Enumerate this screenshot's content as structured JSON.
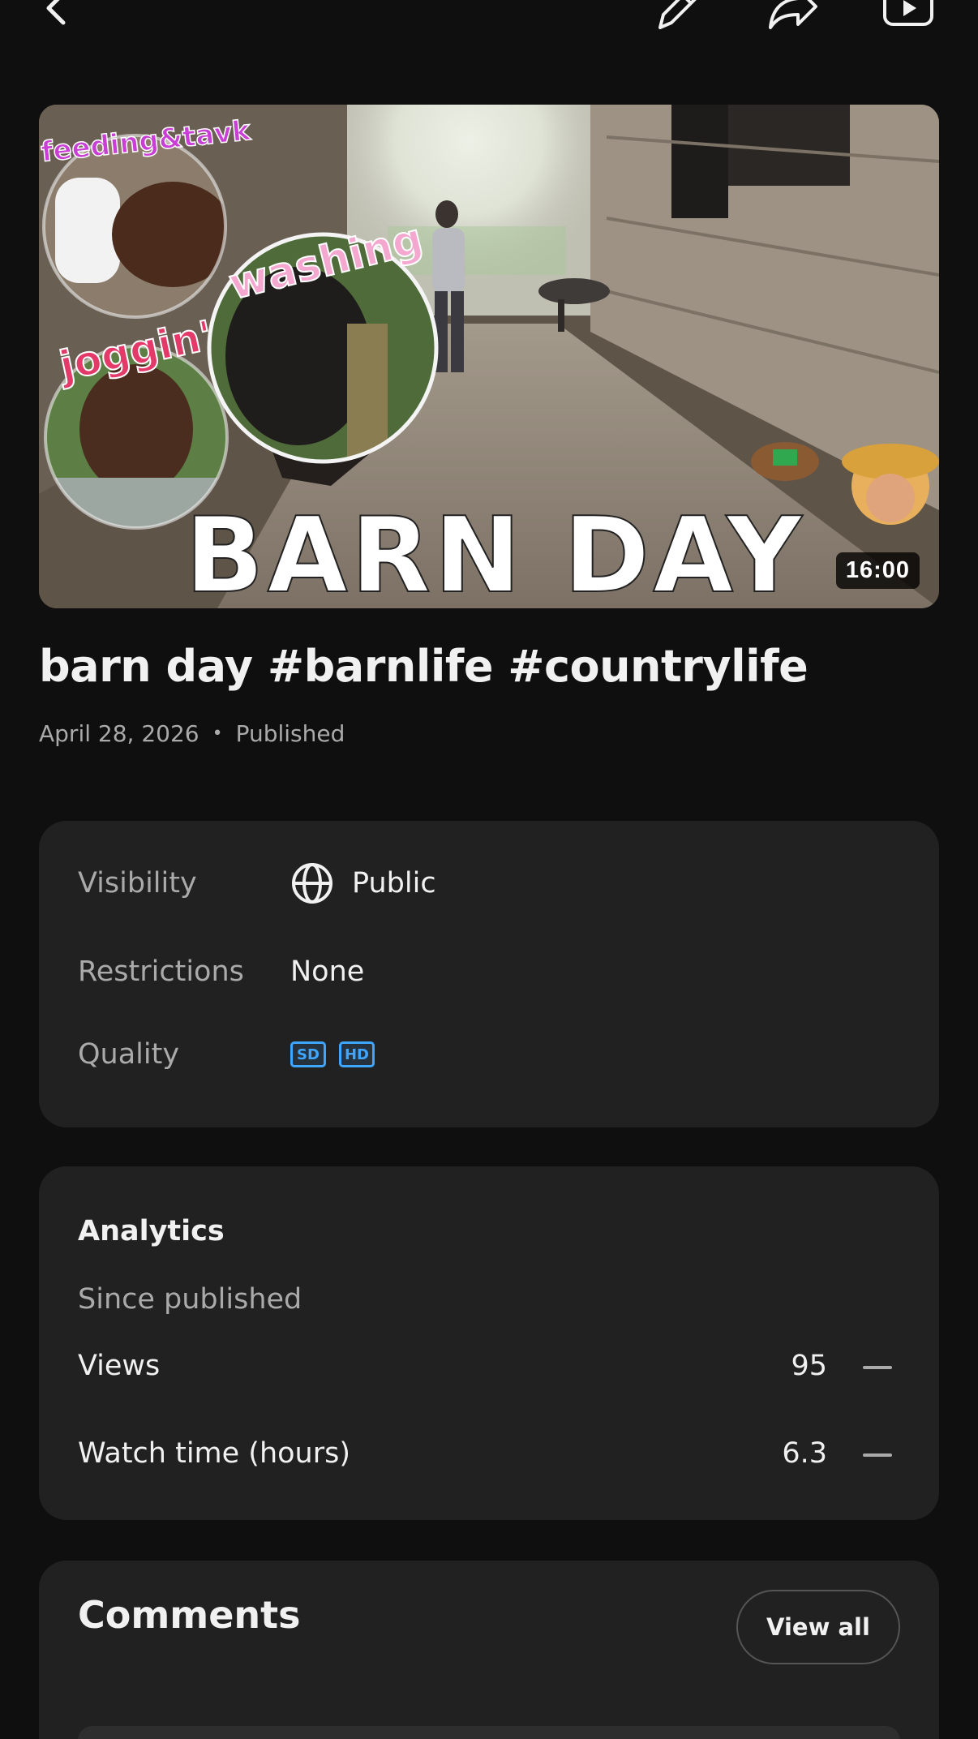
{
  "topbar": {
    "back_icon": "chevron-left-icon",
    "edit_icon": "pencil-icon",
    "share_icon": "share-arrow-icon",
    "open_icon": "youtube-play-icon"
  },
  "video": {
    "thumbnail_text": {
      "headline": "BARN DAY",
      "sticker_feeding": "feeding&tavk",
      "sticker_washing": "washing",
      "sticker_jogging": "joggin'"
    },
    "duration": "16:00",
    "title": "barn day #barnlife #countrylife",
    "date": "April 28, 2026",
    "separator": "•",
    "status": "Published"
  },
  "details": {
    "visibility": {
      "label": "Visibility",
      "value": "Public",
      "icon": "globe-icon"
    },
    "restrictions": {
      "label": "Restrictions",
      "value": "None"
    },
    "quality": {
      "label": "Quality",
      "badges": [
        "SD",
        "HD"
      ]
    }
  },
  "analytics": {
    "title": "Analytics",
    "subtitle": "Since published",
    "rows": [
      {
        "label": "Views",
        "value": "95",
        "trend_icon": "dash-icon"
      },
      {
        "label": "Watch time (hours)",
        "value": "6.3",
        "trend_icon": "dash-icon"
      }
    ]
  },
  "comments": {
    "title": "Comments",
    "view_all": "View all"
  },
  "colors": {
    "background": "#0f0f0f",
    "card": "#212121",
    "text_primary": "#f1f1f1",
    "text_secondary": "#aaaaaa",
    "accent_blue": "#3ea6ff"
  }
}
